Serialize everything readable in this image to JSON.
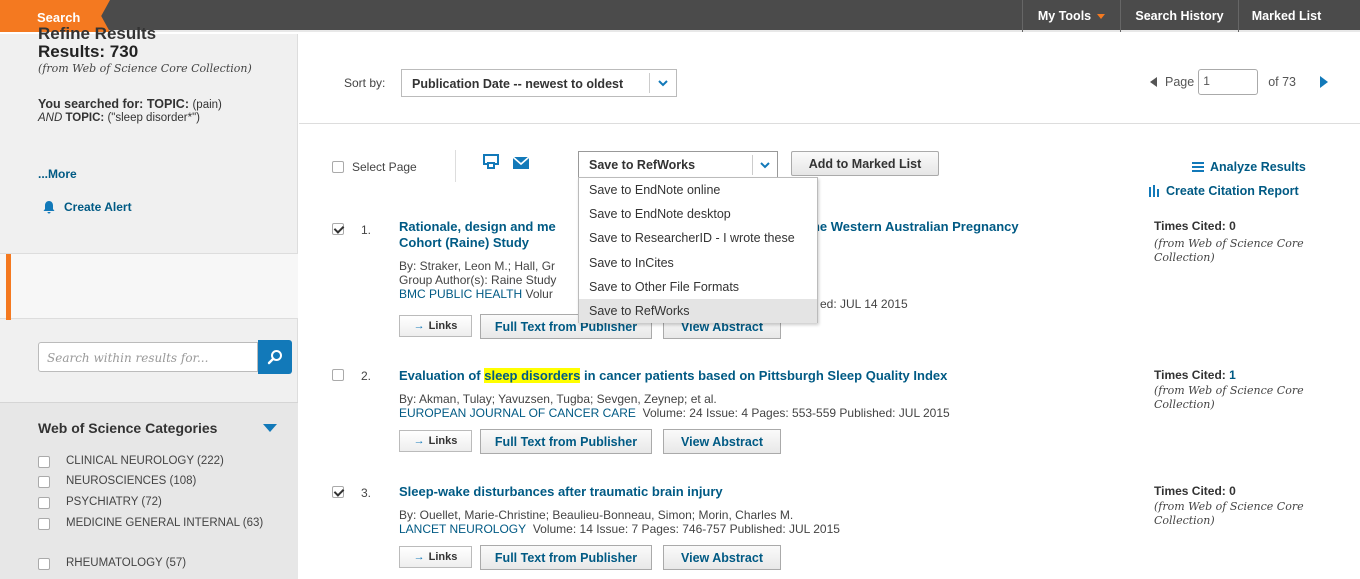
{
  "topbar": {
    "search_tab": "Search",
    "my_tools": "My Tools",
    "search_history": "Search History",
    "marked_list": "Marked List"
  },
  "left": {
    "results_count": "Results: 730",
    "results_source": "(from Web of Science Core Collection)",
    "you_searched_label": "You searched for:",
    "query_part1_label": "TOPIC:",
    "query_part1_value": "(pain)",
    "query_and": "AND",
    "query_part2_label": "TOPIC:",
    "query_part2_value": "(\"sleep disorder*\")",
    "more": "...More",
    "create_alert": "Create Alert",
    "refine_title": "Refine Results",
    "search_within_placeholder": "Search within results for...",
    "categories_title": "Web of Science Categories",
    "categories": [
      {
        "label": "CLINICAL NEUROLOGY (222)"
      },
      {
        "label": "NEUROSCIENCES (108)"
      },
      {
        "label": "PSYCHIATRY (72)"
      },
      {
        "label": "MEDICINE GENERAL INTERNAL (63)"
      },
      {
        "label": "RHEUMATOLOGY (57)"
      }
    ]
  },
  "sort": {
    "label": "Sort by:",
    "value": "Publication Date -- newest to oldest"
  },
  "pager": {
    "page_label": "Page",
    "current": "1",
    "of_label": "of 73"
  },
  "toolbar": {
    "select_page": "Select Page",
    "save_value": "Save to RefWorks",
    "add_marked": "Add to Marked List",
    "analyze": "Analyze Results",
    "citation_report": "Create Citation Report",
    "save_options": [
      "Save to EndNote online",
      "Save to EndNote desktop",
      "Save to ResearcherID - I wrote these",
      "Save to InCites",
      "Save to Other File Formats",
      "Save to RefWorks"
    ]
  },
  "records": [
    {
      "num": "1.",
      "checked": true,
      "title_line1": "Rationale, design and me",
      "title_line1_tail": "of the Western Australian Pregnancy",
      "title_line2": "Cohort (Raine) Study",
      "authors": "By: Straker, Leon M.; Hall, Gr",
      "group": "Group Author(s): Raine Study",
      "journal": "BMC PUBLIC HEALTH",
      "journal_tail": "Volur",
      "published": "ed: JUL 14 2015",
      "links": "Links",
      "full_text": "Full Text from Publisher",
      "abstract": "View Abstract",
      "times_cited_label": "Times Cited:",
      "times_cited": "0",
      "cited_source": "(from Web of Science Core Collection)"
    },
    {
      "num": "2.",
      "checked": false,
      "title_pre": "Evaluation of",
      "title_hl": "sleep disorders",
      "title_post": "in cancer patients based on Pittsburgh Sleep Quality Index",
      "authors": "By: Akman, Tulay; Yavuzsen, Tugba; Sevgen, Zeynep; et al.",
      "journal": "EUROPEAN JOURNAL OF CANCER CARE",
      "details": "Volume: 24   Issue: 4   Pages: 553-559   Published: JUL 2015",
      "links": "Links",
      "full_text": "Full Text from Publisher",
      "abstract": "View Abstract",
      "times_cited_label": "Times Cited:",
      "times_cited": "1",
      "cited_source": "(from Web of Science Core Collection)"
    },
    {
      "num": "3.",
      "checked": true,
      "title": "Sleep-wake disturbances after traumatic brain injury",
      "authors": "By: Ouellet, Marie-Christine; Beaulieu-Bonneau, Simon; Morin, Charles M.",
      "journal": "LANCET NEUROLOGY",
      "details": "Volume: 14   Issue: 7   Pages: 746-757   Published: JUL 2015",
      "links": "Links",
      "full_text": "Full Text from Publisher",
      "abstract": "View Abstract",
      "times_cited_label": "Times Cited:",
      "times_cited": "0",
      "cited_source": "(from Web of Science Core Collection)"
    }
  ],
  "colors": {
    "accent": "#f47920",
    "link": "#005a84",
    "button_blue": "#1279b9",
    "topbar": "#4b4b4b",
    "highlight": "#ffff00"
  }
}
